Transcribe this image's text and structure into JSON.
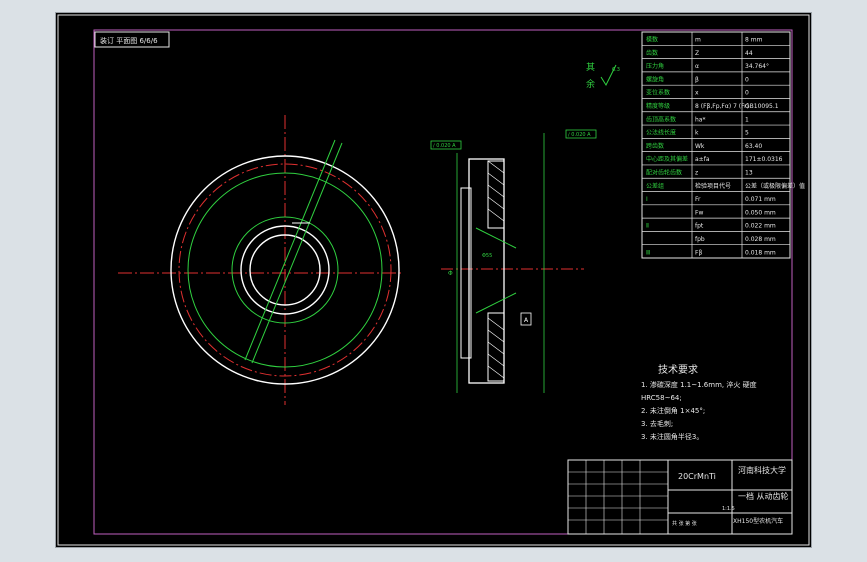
{
  "drawing": {
    "corner_stamp": "装订 平面图 6/6/6",
    "roughness_note_1": "其",
    "roughness_note_2": "余",
    "roughness_value": "6.3",
    "technical": {
      "title": "技术要求",
      "items": [
        "1. 渗碳深度 1.1~1.6mm, 淬火 硬度",
        "HRC58~64;",
        "2. 未注倒角 1×45°;",
        "3. 去毛刺;",
        "3. 未注圆角半径3。"
      ]
    },
    "params": [
      {
        "name": "模数",
        "sym": "m",
        "val": "8 mm"
      },
      {
        "name": "齿数",
        "sym": "Z",
        "val": "44"
      },
      {
        "name": "压力角",
        "sym": "α",
        "val": "34.764°"
      },
      {
        "name": "螺旋角",
        "sym": "β",
        "val": "0"
      },
      {
        "name": "变位系数",
        "sym": "x",
        "val": "0"
      },
      {
        "name": "精度等级",
        "sym": "8 (Fβ,Fp,Fα) 7 (Fr)",
        "val": "GB10095.1"
      },
      {
        "name": "齿顶高系数",
        "sym": "ha*",
        "val": "1"
      },
      {
        "name": "公法线长度",
        "sym": "k",
        "val": "5"
      },
      {
        "name": "跨齿数",
        "sym": "Wk",
        "val": "63.40"
      },
      {
        "name": "中心距及其偏差",
        "sym": "a±fa",
        "val": "171±0.0316"
      },
      {
        "name": "配对齿轮齿数",
        "sym": "z",
        "val": "13"
      },
      {
        "name": "公差组",
        "sym": "检验项目代号",
        "val": "公差（或极限偏差）值"
      },
      {
        "name": "Ⅰ",
        "sym": "Fr",
        "val": "0.071 mm"
      },
      {
        "name": "",
        "sym": "Fw",
        "val": "0.050 mm"
      },
      {
        "name": "Ⅱ",
        "sym": "fpt",
        "val": "0.022 mm"
      },
      {
        "name": "",
        "sym": "fpb",
        "val": "0.028 mm"
      },
      {
        "name": "Ⅲ",
        "sym": "Fβ",
        "val": "0.018 mm"
      }
    ],
    "title_block": {
      "material": "20CrMnTi",
      "school": "河南科技大学",
      "part_name": "一档 从动齿轮",
      "project": "XH150型农机汽车",
      "scale": "1:1.5",
      "sheet": "共 张 第 张"
    },
    "dims": {
      "top_callout": "∕ 0.020 A",
      "right_callout": "∕ 0.020 A",
      "datum": "A",
      "bore_label": "Φ",
      "slot_label": "Φ55"
    }
  }
}
